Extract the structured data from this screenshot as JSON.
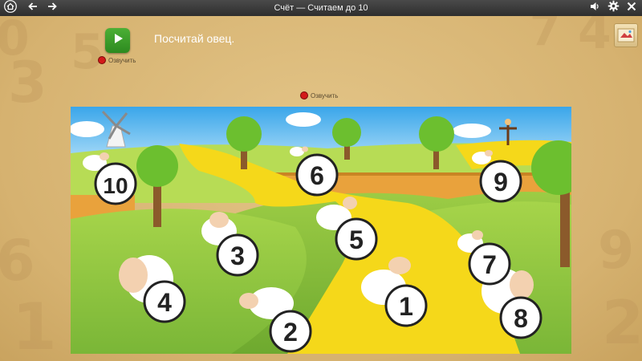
{
  "window": {
    "title": "Счёт — Считаем до 10"
  },
  "toolbar": {
    "home_icon": "home-icon",
    "back_icon": "arrow-left-icon",
    "forward_icon": "arrow-right-icon",
    "sound_icon": "speaker-icon",
    "settings_icon": "gear-icon",
    "close_icon": "close-icon"
  },
  "task": {
    "text": "Посчитай овец.",
    "record_label": "Озвучить"
  },
  "scene_record_label": "Озвучить",
  "sheep_numbers": [
    "1",
    "2",
    "3",
    "4",
    "5",
    "6",
    "7",
    "8",
    "9",
    "10"
  ],
  "colors": {
    "accent": "#3a9b28",
    "record": "#d31a1a",
    "path": "#f5d81a",
    "grass": "#8cc63e"
  }
}
